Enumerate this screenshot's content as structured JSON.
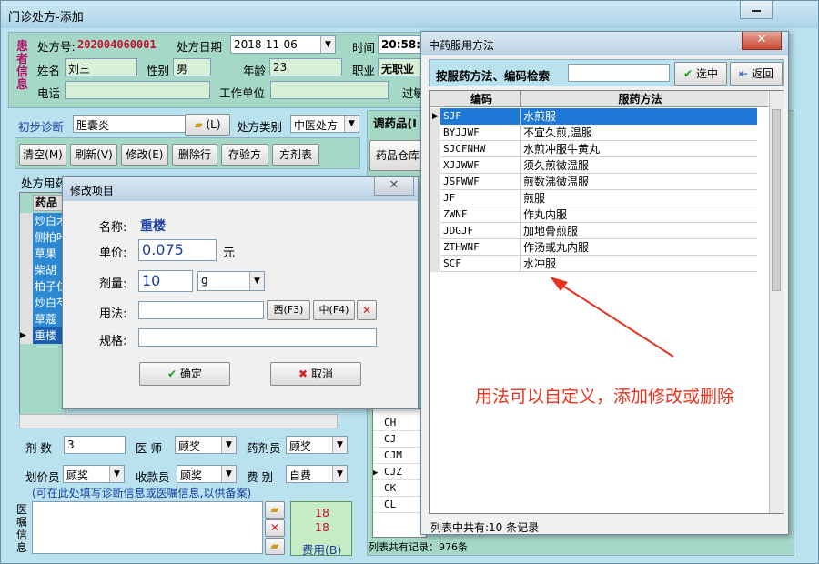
{
  "window": {
    "title": "门诊处方-添加"
  },
  "patient": {
    "section": "患者信息",
    "rx_no_label": "处方号:",
    "rx_no": "202004060001",
    "date_label": "处方日期",
    "date": "2018-11-06",
    "time_label": "时间",
    "time": "20:58:",
    "name_label": "姓名",
    "name": "刘三",
    "sex_label": "性别",
    "sex": "男",
    "age_label": "年龄",
    "age": "23",
    "job_label": "职业",
    "job": "无职业",
    "phone_label": "电话",
    "work_label": "工作单位",
    "allergy_label": "过敏"
  },
  "diagnosis": {
    "label": "初步诊断",
    "value": "胆囊炎",
    "open_btn": "(L)",
    "type_label": "处方类别",
    "type": "中医处方"
  },
  "toolbar": {
    "clear": "清空(M)",
    "refresh": "刷新(V)",
    "edit": "修改(E)",
    "delete_row": "删除行",
    "save_rx": "存验方",
    "formula": "方剂表"
  },
  "right_panel": {
    "title": "调药品(I",
    "warehouse": "药品仓库",
    "codes": [
      "CH",
      "CJ",
      "CJM",
      "CJZ",
      "CK",
      "CL"
    ],
    "selected_code": "CJZ",
    "footer": "列表共有记录：976条"
  },
  "rx_tab": {
    "label": "处方用药",
    "header": "药品",
    "items": [
      "炒白术",
      "侧柏叶",
      "草果",
      "柴胡",
      "柏子仁",
      "炒白芍",
      "草蔻",
      "重楼"
    ]
  },
  "bottom": {
    "dose_label": "剂  数",
    "dose": "3",
    "doctor_label": "医  师",
    "doctor": "顾奖",
    "dispenser_label": "药剂员",
    "dispenser": "顾奖",
    "pricer_label": "划价员",
    "pricer": "顾奖",
    "cashier_label": "收款员",
    "cashier": "顾奖",
    "fee_type_label": "费  别",
    "fee_type": "自费",
    "note": "(可在此处填写诊断信息或医嘱信息,以供备案)",
    "advice_label": "医嘱信息",
    "fee_top": "18",
    "fee_mid": "18",
    "fee_btn": "费用(B)"
  },
  "edit_dialog": {
    "title": "修改项目",
    "name_label": "名称:",
    "name": "重楼",
    "price_label": "单价:",
    "price": "0.075",
    "price_unit": "元",
    "qty_label": "剂量:",
    "qty": "10",
    "qty_unit": "g",
    "usage_label": "用法:",
    "west_btn": "西(F3)",
    "cn_btn": "中(F4)",
    "spec_label": "规格:",
    "ok": "确定",
    "cancel": "取消"
  },
  "usage_dialog": {
    "title": "中药服用方法",
    "search_label": "按服药方法、编码检索",
    "select_btn": "选中",
    "back_btn": "返回",
    "col_code": "编码",
    "col_method": "服药方法",
    "rows": [
      {
        "code": "SJF",
        "method": "水煎服"
      },
      {
        "code": "BYJJWF",
        "method": "不宜久煎,温服"
      },
      {
        "code": "SJCFNHW",
        "method": "水煎冲服牛黄丸"
      },
      {
        "code": "XJJWWF",
        "method": "须久煎微温服"
      },
      {
        "code": "JSFWWF",
        "method": "煎数沸微温服"
      },
      {
        "code": "JF",
        "method": "煎服"
      },
      {
        "code": "ZWNF",
        "method": "作丸内服"
      },
      {
        "code": "JDGJF",
        "method": "加地骨煎服"
      },
      {
        "code": "ZTHWNF",
        "method": "作汤或丸内服"
      },
      {
        "code": "SCF",
        "method": "水冲服"
      }
    ],
    "status": "列表中共有:10 条记录"
  },
  "annotation": {
    "text": "用法可以自定义，添加修改或删除",
    "color": "#e8321e"
  },
  "colors": {
    "accent_green": "#14a014",
    "select_blue": "#1e78d8",
    "red_text": "#c8102e"
  }
}
